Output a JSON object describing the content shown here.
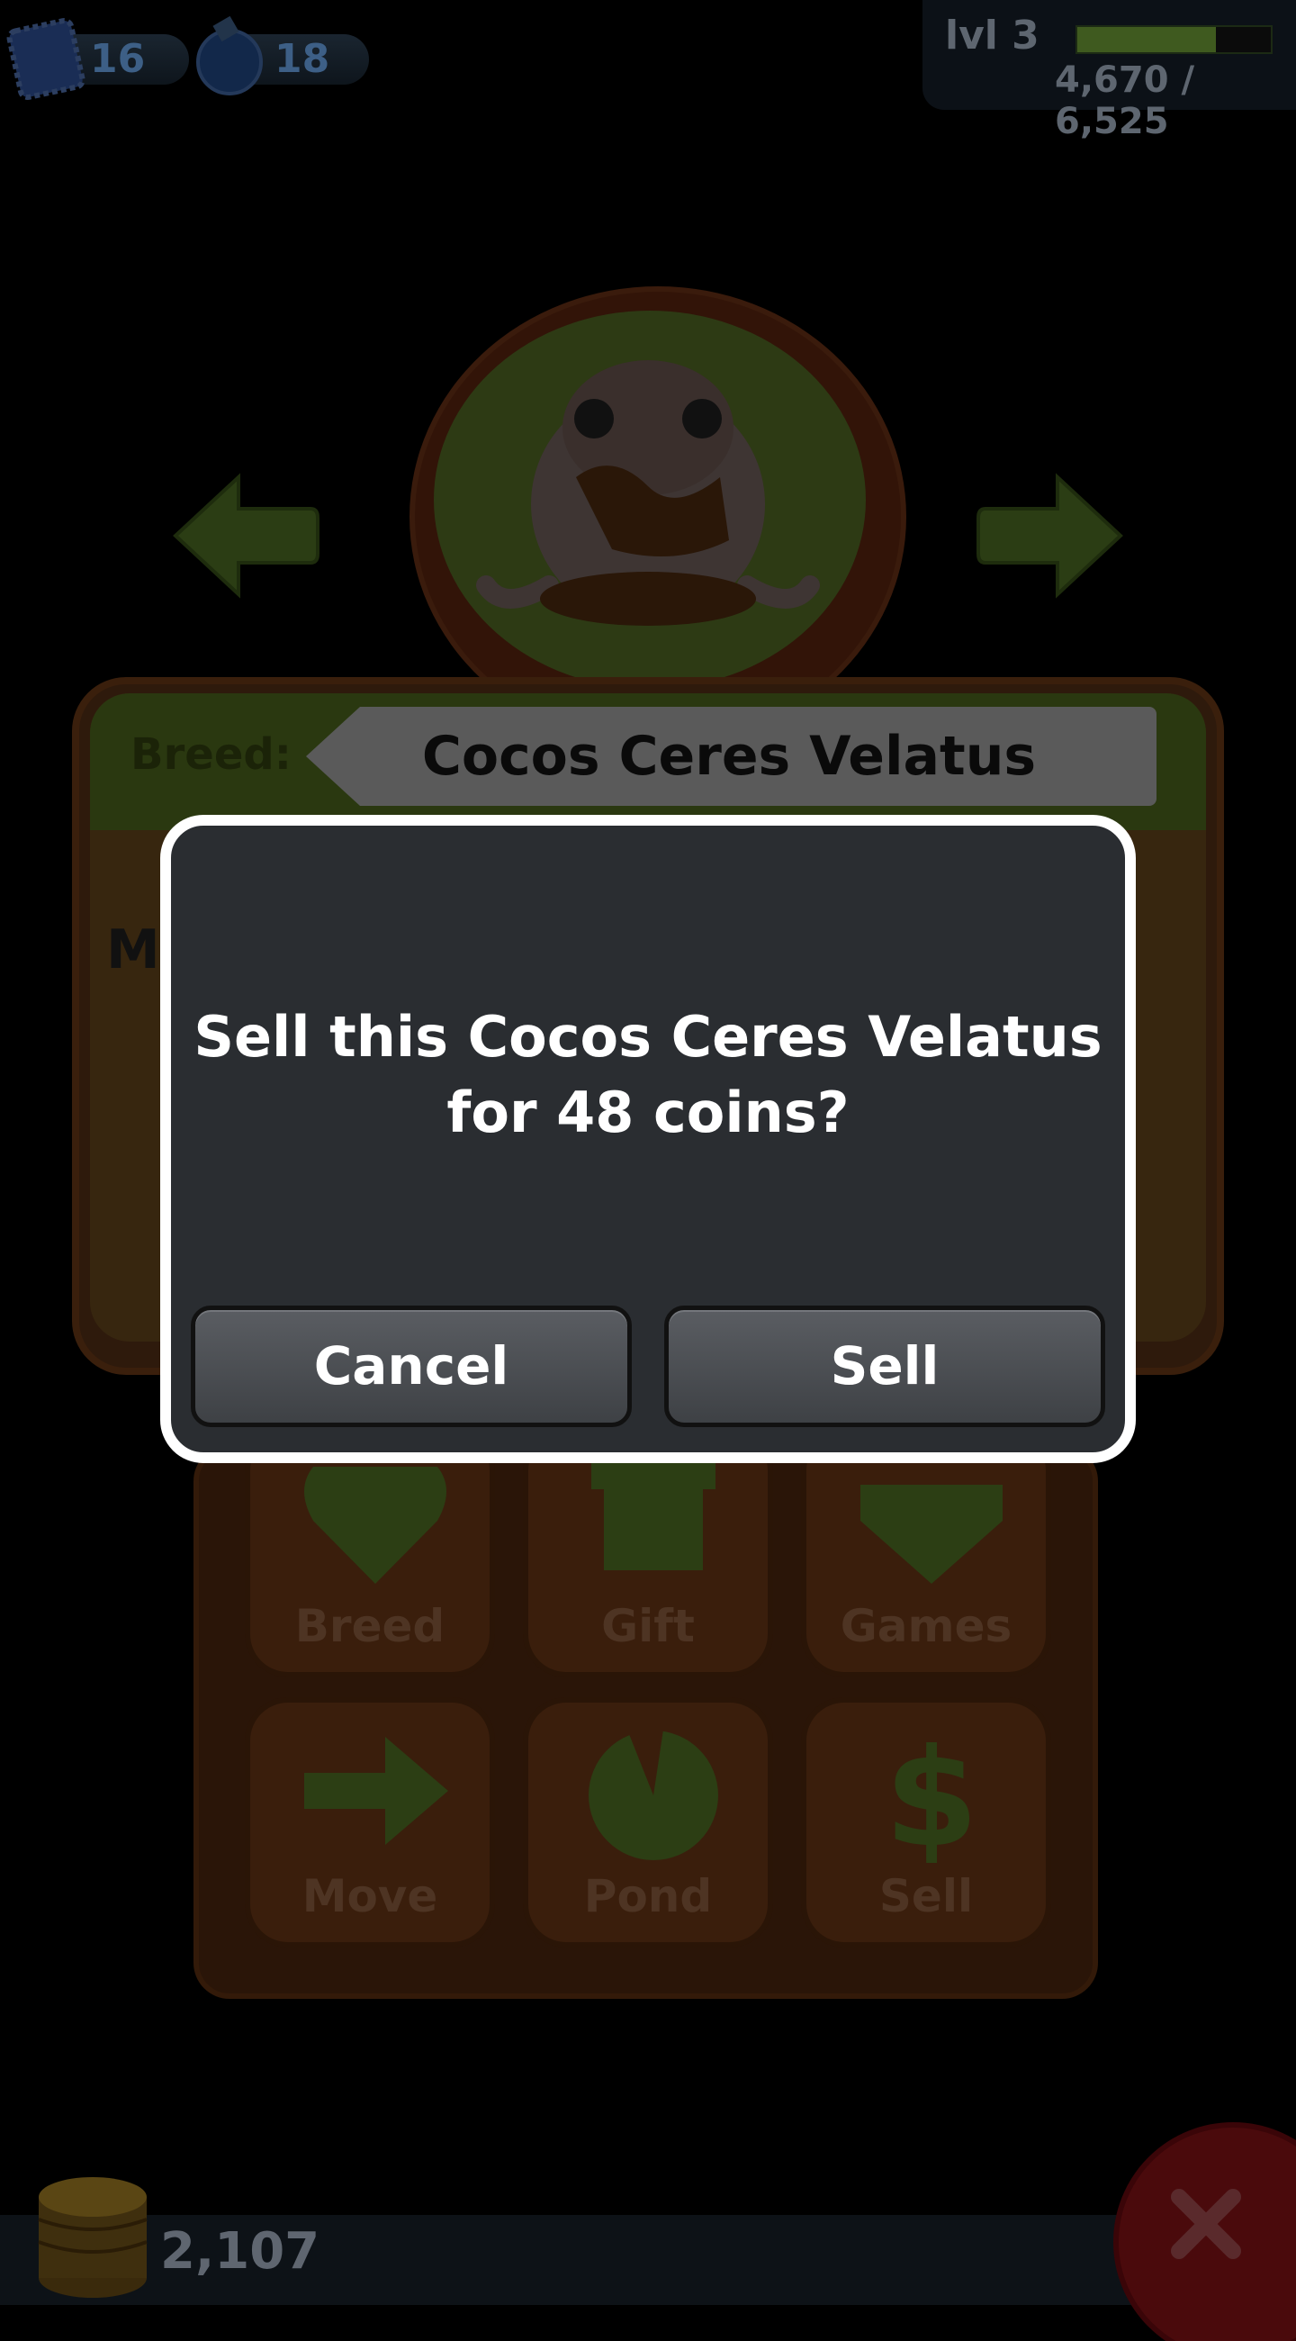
{
  "hud": {
    "stamps_count": "16",
    "potions_count": "18",
    "level_label": "lvl 3",
    "xp_text": "4,670 / 6,525",
    "xp_progress": 0.716
  },
  "card": {
    "breed_label": "Breed:",
    "breed_name": "Cocos Ceres Velatus",
    "partial_label": "M"
  },
  "actions": [
    {
      "label": "Breed",
      "icon": "heart-icon"
    },
    {
      "label": "Gift",
      "icon": "gift-icon"
    },
    {
      "label": "Games",
      "icon": "spinning-top-icon"
    },
    {
      "label": "Move",
      "icon": "arrow-right-icon"
    },
    {
      "label": "Pond",
      "icon": "lilypad-icon"
    },
    {
      "label": "Sell",
      "icon": "dollar-icon"
    }
  ],
  "footer": {
    "coins": "2,107"
  },
  "dialog": {
    "message_line1": "Sell this Cocos Ceres Velatus",
    "message_line2": "for 48 coins?",
    "cancel_label": "Cancel",
    "confirm_label": "Sell"
  },
  "colors": {
    "dialog_bg": "#2a2d31",
    "dialog_border": "#ffffff",
    "button_bg": "#4a4d52"
  }
}
